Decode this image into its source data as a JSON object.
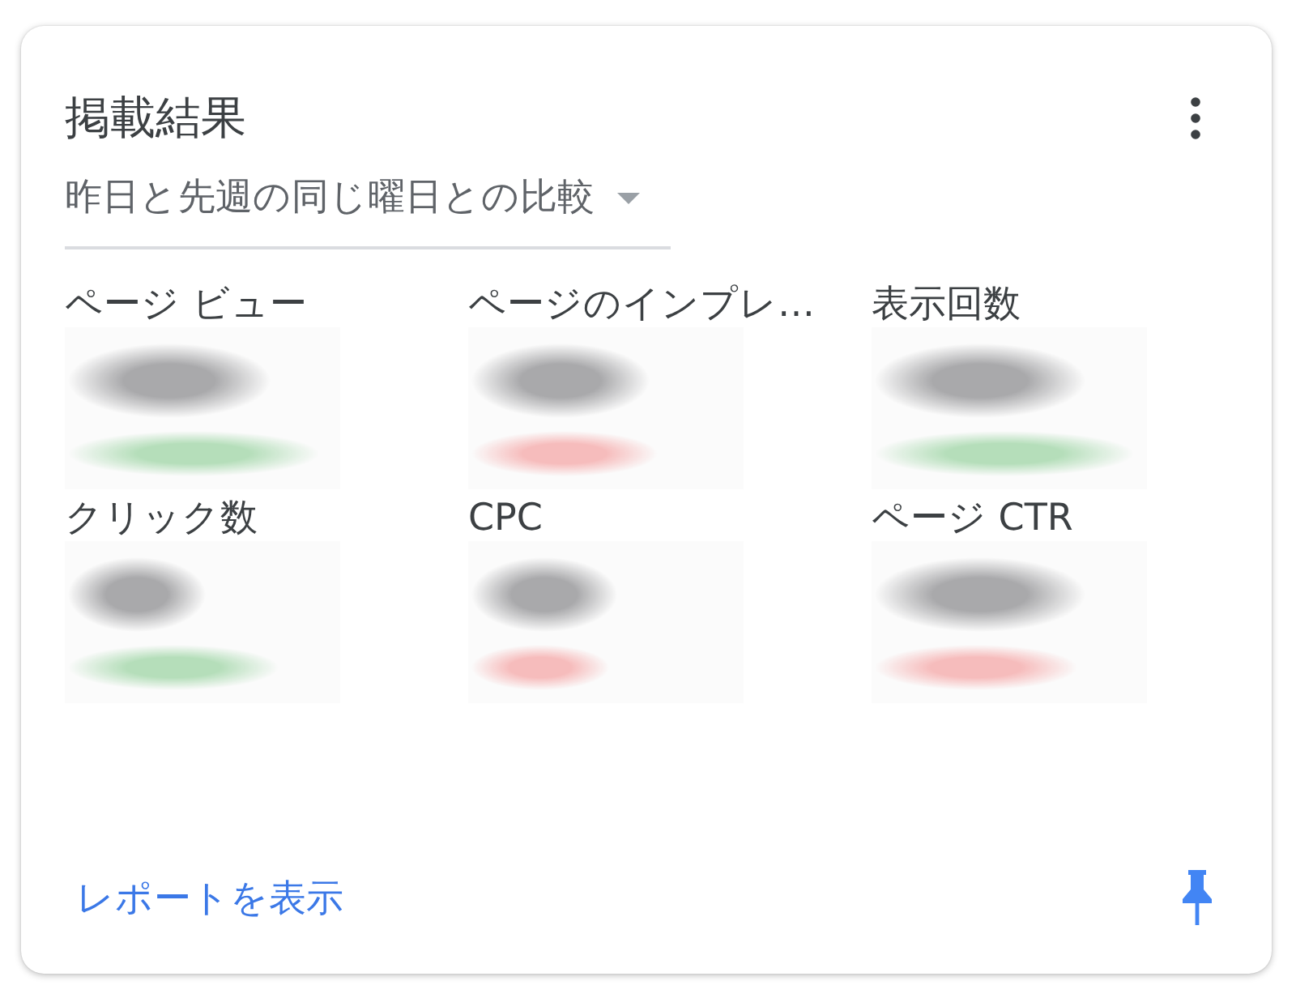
{
  "card": {
    "title": "掲載結果"
  },
  "comparison": {
    "value": "昨日と先週の同じ曜日との比較"
  },
  "metrics": [
    {
      "label": "ページ ビュー",
      "color": "#b5deba"
    },
    {
      "label": "ページのインプレ…",
      "color": "#f6bcbc"
    },
    {
      "label": "表示回数",
      "color": "#b5deba"
    },
    {
      "label": "クリック数",
      "color": "#b5deba"
    },
    {
      "label": "CPC",
      "color": "#f6bcbc"
    },
    {
      "label": "ページ CTR",
      "color": "#f6bcbc"
    }
  ],
  "footer": {
    "link": "レポートを表示"
  }
}
